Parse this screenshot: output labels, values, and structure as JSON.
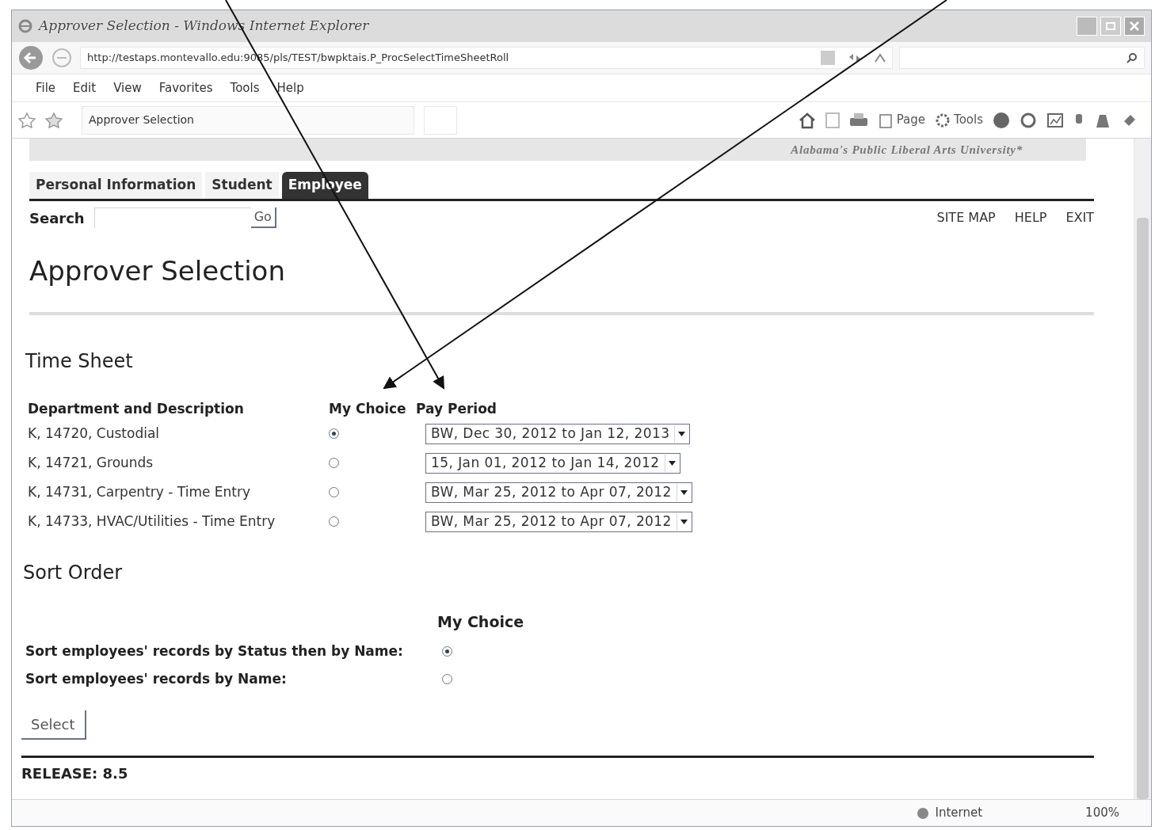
{
  "window": {
    "title": "Approver Selection - Windows Internet Explorer"
  },
  "address_bar": {
    "url": "http://testaps.montevallo.edu:9085/pls/TEST/bwpktais.P_ProcSelectTimeSheetRoll"
  },
  "menu": [
    "File",
    "Edit",
    "View",
    "Favorites",
    "Tools",
    "Help"
  ],
  "browser_tab": {
    "title": "Approver Selection"
  },
  "command_bar": [
    {
      "kind": "page",
      "label": "Page"
    },
    {
      "kind": "tools",
      "label": "Tools"
    }
  ],
  "banner": {
    "tagline": "Alabama's Public Liberal Arts University*"
  },
  "nav_tabs": [
    {
      "label": "Personal Information",
      "selected": false
    },
    {
      "label": "Student",
      "selected": false
    },
    {
      "label": "Employee",
      "selected": true
    }
  ],
  "search": {
    "label": "Search",
    "button": "Go"
  },
  "top_links": [
    "SITE MAP",
    "HELP",
    "EXIT"
  ],
  "page_title": "Approver Selection",
  "time_sheet": {
    "heading": "Time Sheet",
    "columns": [
      "Department and Description",
      "My Choice",
      "Pay Period"
    ],
    "rows": [
      {
        "department": "K, 14720, Custodial",
        "selected": true,
        "pay_period": "BW, Dec 30, 2012 to Jan 12, 2013"
      },
      {
        "department": "K, 14721, Grounds",
        "selected": false,
        "pay_period": "15, Jan 01, 2012 to Jan 14, 2012"
      },
      {
        "department": "K, 14731, Carpentry - Time Entry",
        "selected": false,
        "pay_period": "BW, Mar 25, 2012 to Apr 07, 2012"
      },
      {
        "department": "K, 14733, HVAC/Utilities - Time Entry",
        "selected": false,
        "pay_period": "BW, Mar 25, 2012 to Apr 07, 2012"
      }
    ]
  },
  "sort_order": {
    "heading": "Sort Order",
    "column": "My Choice",
    "options": [
      {
        "label": "Sort employees' records by Status then by Name:",
        "selected": true
      },
      {
        "label": "Sort employees' records by Name:",
        "selected": false
      }
    ]
  },
  "select_button": "Select",
  "release": "RELEASE: 8.5",
  "status_bar": {
    "zone": "Internet",
    "zoom": "100%"
  }
}
